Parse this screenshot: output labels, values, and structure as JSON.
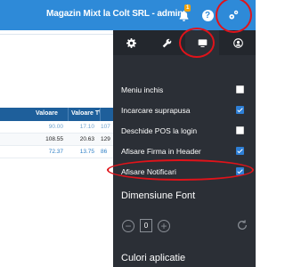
{
  "header": {
    "title": "Magazin Mixt la Colt SRL - admin",
    "notification_count": "1",
    "help_label": "?"
  },
  "table": {
    "columns": [
      "Valoare",
      "Valoare T\\"
    ],
    "rows": [
      [
        "90.00",
        "17.10",
        "107"
      ],
      [
        "108.55",
        "20.63",
        "129"
      ],
      [
        "72.37",
        "13.75",
        "86"
      ]
    ]
  },
  "settings": {
    "tabs": [
      {
        "icon": "gear-icon"
      },
      {
        "icon": "wrench-icon"
      },
      {
        "icon": "monitor-icon",
        "active": true
      },
      {
        "icon": "user-circle-icon"
      }
    ],
    "options": [
      {
        "label": "Meniu inchis",
        "checked": false
      },
      {
        "label": "Incarcare suprapusa",
        "checked": true
      },
      {
        "label": "Deschide POS la login",
        "checked": false
      },
      {
        "label": "Afisare Firma in Header",
        "checked": true
      },
      {
        "label": "Afisare Notificari",
        "checked": true
      }
    ],
    "font_section_title": "Dimensiune Font",
    "font_value": "0",
    "colors_section_title": "Culori aplicatie"
  },
  "colors": {
    "header": "#2e8ad8",
    "panel": "#2b2f36",
    "checkbox_on": "#2e7fd6",
    "highlight": "#e0131a"
  }
}
